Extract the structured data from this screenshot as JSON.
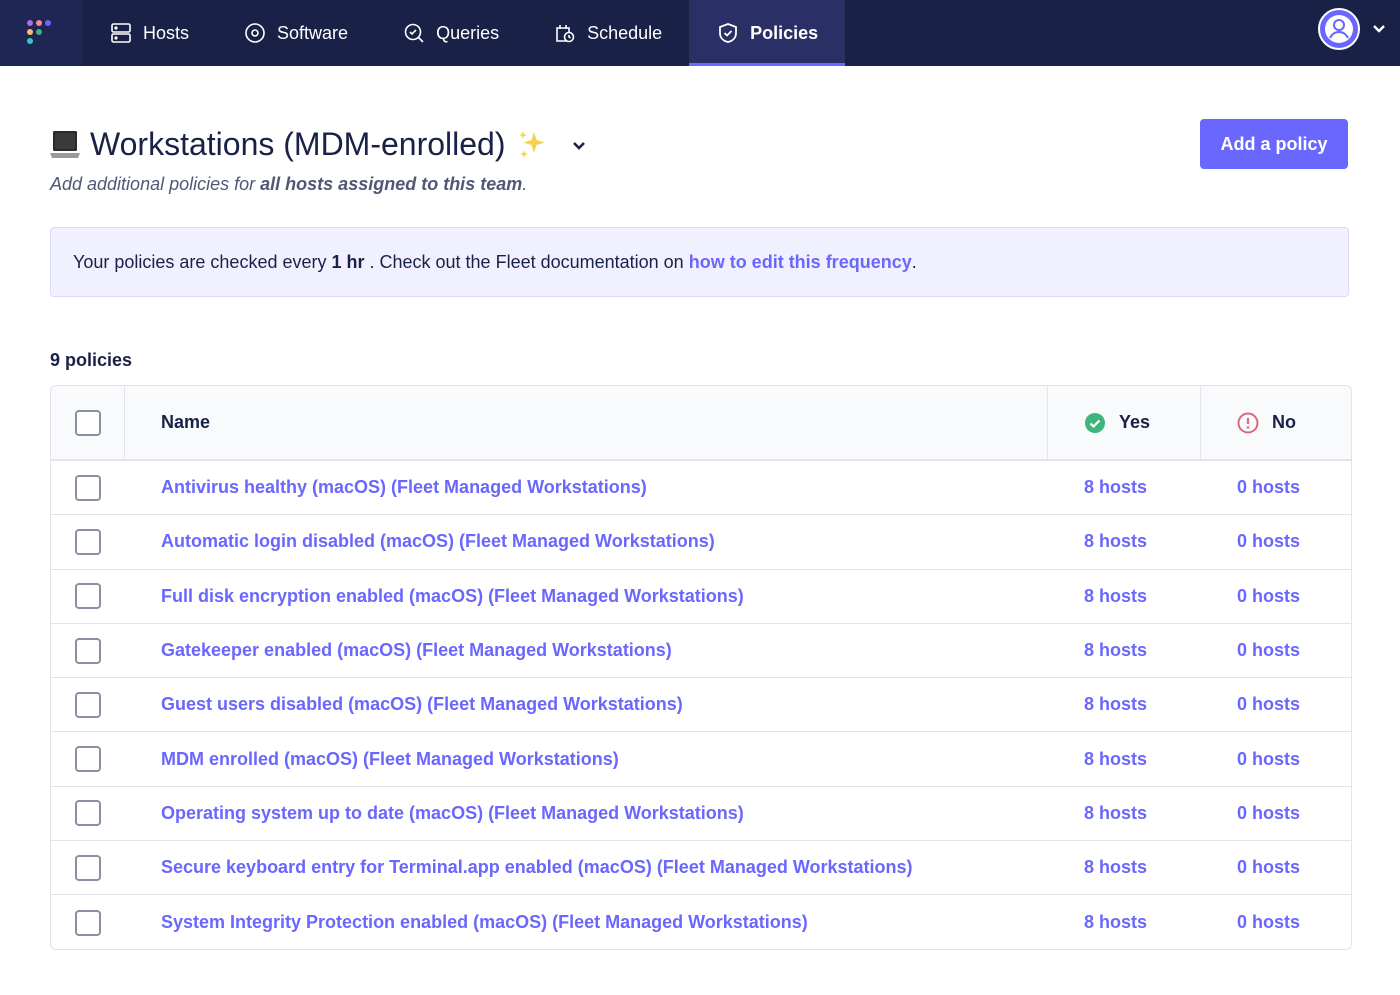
{
  "nav": {
    "items": [
      {
        "label": "Hosts",
        "icon": "hosts-icon"
      },
      {
        "label": "Software",
        "icon": "software-icon"
      },
      {
        "label": "Queries",
        "icon": "queries-icon"
      },
      {
        "label": "Schedule",
        "icon": "schedule-icon"
      },
      {
        "label": "Policies",
        "icon": "policies-icon",
        "active": true
      }
    ]
  },
  "header": {
    "title": "Workstations (MDM-enrolled)",
    "subtitle_prefix": "Add additional policies for",
    "subtitle_bold": "all hosts assigned to this team",
    "subtitle_suffix": ".",
    "add_button": "Add a policy"
  },
  "banner": {
    "prefix": "Your policies are checked every",
    "bold": "1 hr",
    "middle": ". Check out the Fleet documentation on",
    "link": "how to edit this frequency",
    "suffix": "."
  },
  "policy_count": "9 policies",
  "table": {
    "headers": {
      "name": "Name",
      "yes": "Yes",
      "no": "No"
    },
    "rows": [
      {
        "name": "Antivirus healthy (macOS) (Fleet Managed Workstations)",
        "yes": "8 hosts",
        "no": "0 hosts"
      },
      {
        "name": "Automatic login disabled (macOS) (Fleet Managed Workstations)",
        "yes": "8 hosts",
        "no": "0 hosts"
      },
      {
        "name": "Full disk encryption enabled (macOS) (Fleet Managed Workstations)",
        "yes": "8 hosts",
        "no": "0 hosts"
      },
      {
        "name": "Gatekeeper enabled (macOS) (Fleet Managed Workstations)",
        "yes": "8 hosts",
        "no": "0 hosts"
      },
      {
        "name": "Guest users disabled (macOS) (Fleet Managed Workstations)",
        "yes": "8 hosts",
        "no": "0 hosts"
      },
      {
        "name": "MDM enrolled (macOS) (Fleet Managed Workstations)",
        "yes": "8 hosts",
        "no": "0 hosts"
      },
      {
        "name": "Operating system up to date (macOS) (Fleet Managed Workstations)",
        "yes": "8 hosts",
        "no": "0 hosts"
      },
      {
        "name": "Secure keyboard entry for Terminal.app enabled (macOS) (Fleet Managed Workstations)",
        "yes": "8 hosts",
        "no": "0 hosts"
      },
      {
        "name": "System Integrity Protection enabled (macOS) (Fleet Managed Workstations)",
        "yes": "8 hosts",
        "no": "0 hosts"
      }
    ]
  },
  "colors": {
    "nav_bg": "#192147",
    "accent": "#6a67fe",
    "success": "#3db67b",
    "error": "#d66c7b"
  }
}
